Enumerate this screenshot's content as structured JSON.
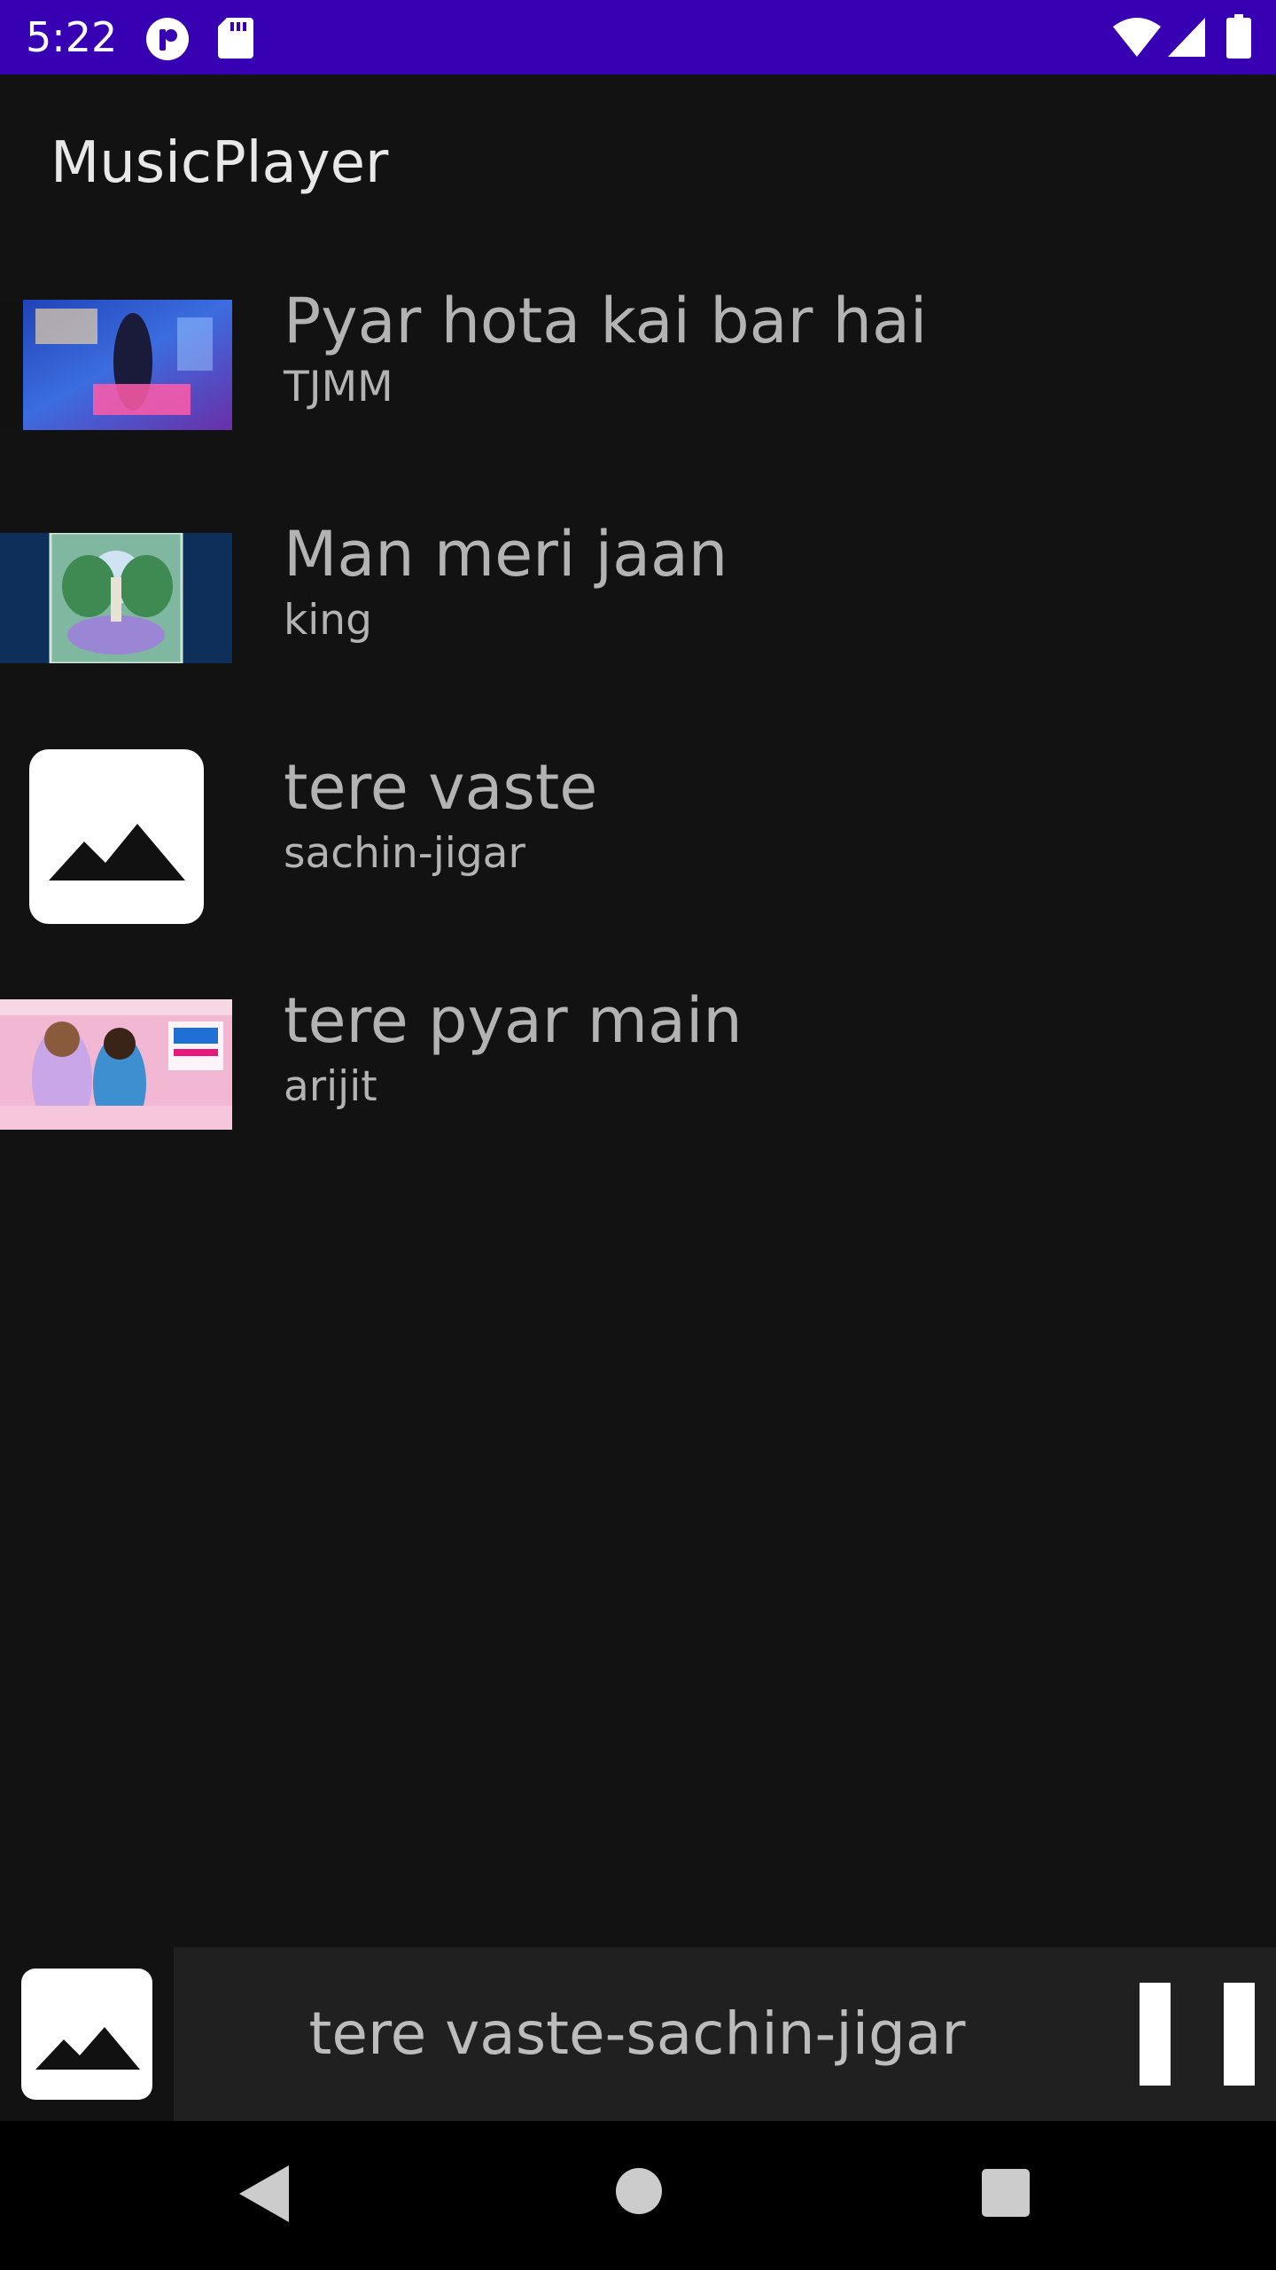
{
  "status_bar": {
    "time": "5:22",
    "background_color": "#3700b3",
    "icons": [
      "app-notification-icon",
      "sd-card-icon",
      "wifi-icon",
      "cell-signal-icon",
      "battery-icon"
    ]
  },
  "app_bar": {
    "title": "MusicPlayer"
  },
  "songs": [
    {
      "title": "Pyar hota kai bar hai",
      "artist": "TJMM",
      "thumbnail": "video-thumbnail"
    },
    {
      "title": "Man meri jaan",
      "artist": "king",
      "thumbnail": "album-art"
    },
    {
      "title": "tere vaste",
      "artist": "sachin-jigar",
      "thumbnail": "image-placeholder-icon"
    },
    {
      "title": "tere pyar main",
      "artist": "arijit",
      "thumbnail": "video-thumbnail"
    }
  ],
  "mini_player": {
    "now_playing": "tere vaste-sachin-jigar",
    "art": "image-placeholder-icon",
    "control": "pause-icon"
  },
  "nav_bar": {
    "buttons": [
      "back-icon",
      "home-icon",
      "recents-icon"
    ]
  },
  "colors": {
    "background": "#121212",
    "text_secondary": "#b3b3b3",
    "mini_player_panel": "#202020"
  }
}
